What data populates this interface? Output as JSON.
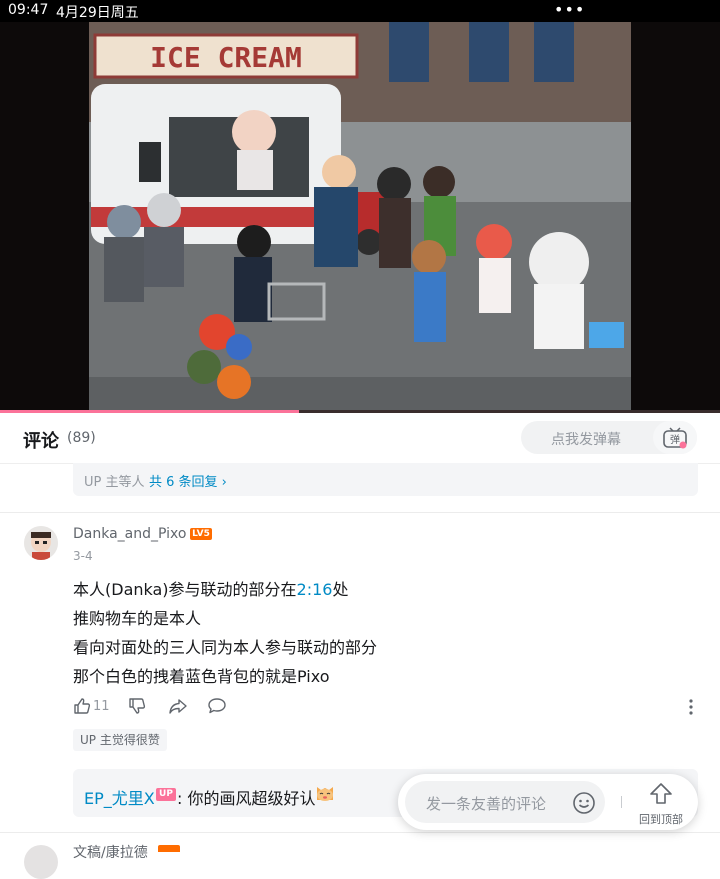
{
  "status_bar": {
    "time": "09:47",
    "date": "4月29日周五",
    "dots": "•••"
  },
  "video": {
    "sign_text": "ICE CREAM",
    "progress_fraction": 0.415
  },
  "comments_header": {
    "title": "评论",
    "count": "(89)",
    "danmaku_placeholder": "点我发弹幕",
    "danmaku_button_label": "弹"
  },
  "reply_summary": {
    "prefix": "UP 主等人",
    "link": "共 6 条回复 ›"
  },
  "comment": {
    "username": "Danka_and_Pixo",
    "level": "LV5",
    "date": "3-4",
    "lines": [
      {
        "before": "本人(Danka)参与联动的部分在",
        "timestamp": "2:16",
        "after": "处"
      },
      {
        "text": "推购物车的是本人"
      },
      {
        "text": "看向对面处的三人同为本人参与联动的部分"
      },
      {
        "text": "那个白色的拽着蓝色背包的就是Pixo"
      }
    ],
    "like_count": "11",
    "up_liked_badge": "UP 主觉得很赞"
  },
  "sub_reply": {
    "name": "EP_尤里X",
    "badge": "UP",
    "text": ": 你的画风超级好认"
  },
  "comment_bar": {
    "placeholder": "发一条友善的评论",
    "to_top_label": "回到顶部"
  },
  "next_comment": {
    "username": "文稿/康拉德"
  },
  "colors": {
    "accent_pink": "#fb7299",
    "link_blue": "#008ac5",
    "level_orange": "#ff6c00"
  }
}
